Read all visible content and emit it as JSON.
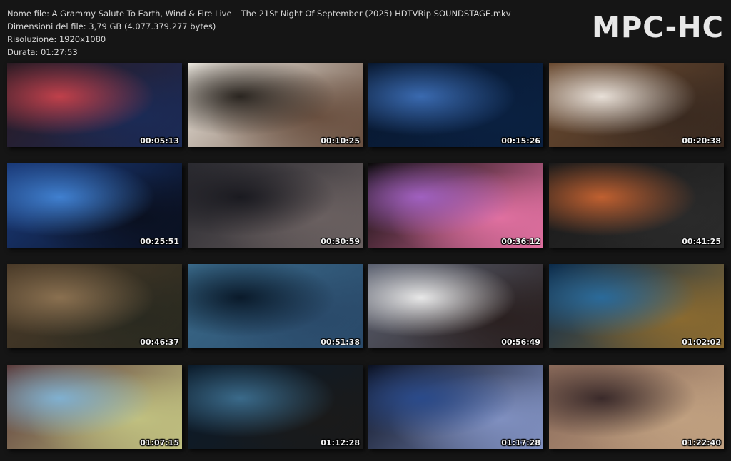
{
  "header": {
    "filename": "Nome file: A Grammy Salute To Earth, Wind & Fire Live – The 21St Night Of September (2025) HDTVRip SOUNDSTAGE.mkv",
    "filesize": "Dimensioni del file: 3,79 GB (4.077.379.277 bytes)",
    "resolution": "Risoluzione: 1920x1080",
    "duration": "Durata: 01:27:53"
  },
  "brand": "MPC-HC",
  "thumbnails": [
    {
      "timestamp": "00:05:13",
      "colors": [
        "#2a1a22",
        "#c0404a",
        "#1b2a55"
      ]
    },
    {
      "timestamp": "00:10:25",
      "colors": [
        "#ece8e0",
        "#2a2520",
        "#6a5040"
      ]
    },
    {
      "timestamp": "00:15:26",
      "colors": [
        "#081830",
        "#3a6ab0",
        "#0a2040"
      ]
    },
    {
      "timestamp": "00:20:38",
      "colors": [
        "#6a4a30",
        "#e8e0d8",
        "#3a2a20"
      ]
    },
    {
      "timestamp": "00:25:51",
      "colors": [
        "#1a3a7a",
        "#4080d0",
        "#0a1020"
      ]
    },
    {
      "timestamp": "00:30:59",
      "colors": [
        "#2a2a30",
        "#1a1a20",
        "#6a6060"
      ]
    },
    {
      "timestamp": "00:36:12",
      "colors": [
        "#0a0a0a",
        "#a060c0",
        "#e070a0"
      ]
    },
    {
      "timestamp": "00:41:25",
      "colors": [
        "#1a1a1a",
        "#c06030",
        "#2a2a2a"
      ]
    },
    {
      "timestamp": "00:46:37",
      "colors": [
        "#4a3a28",
        "#8a7050",
        "#2a2a20"
      ]
    },
    {
      "timestamp": "00:51:38",
      "colors": [
        "#3a6a8a",
        "#0a1a2a",
        "#2a4a6a"
      ]
    },
    {
      "timestamp": "00:56:49",
      "colors": [
        "#5a6070",
        "#e8e8e8",
        "#2a2020"
      ]
    },
    {
      "timestamp": "01:02:02",
      "colors": [
        "#0a2a4a",
        "#2a6a9a",
        "#8a6a30"
      ]
    },
    {
      "timestamp": "01:07:15",
      "colors": [
        "#5a3a3a",
        "#80b0d0",
        "#c0c080"
      ]
    },
    {
      "timestamp": "01:12:28",
      "colors": [
        "#0a1a2a",
        "#3a6a8a",
        "#1a1a1a"
      ]
    },
    {
      "timestamp": "01:17:28",
      "colors": [
        "#0a1020",
        "#2a4a8a",
        "#8090c0"
      ]
    },
    {
      "timestamp": "01:22:40",
      "colors": [
        "#8a6a5a",
        "#3a2a2a",
        "#c0a080"
      ]
    }
  ]
}
